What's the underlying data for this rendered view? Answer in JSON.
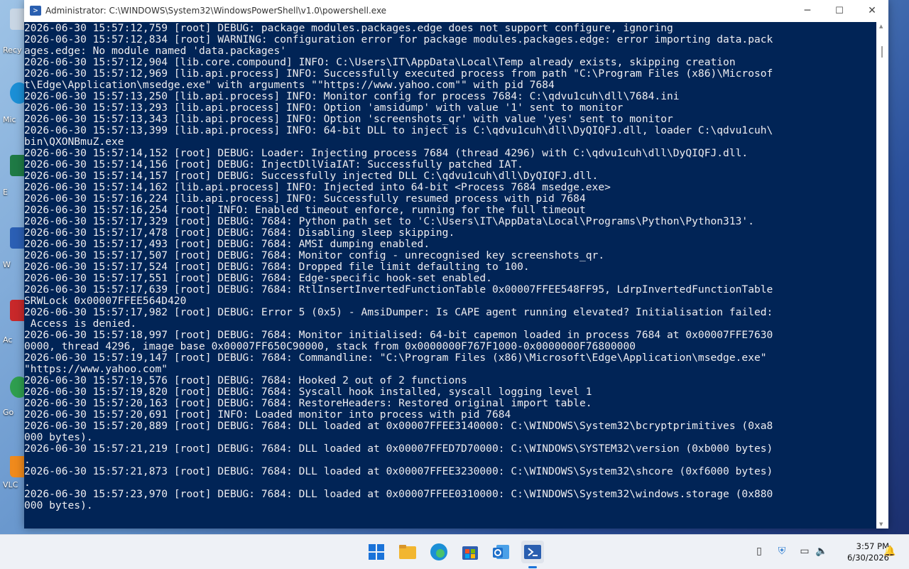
{
  "window": {
    "title": "Administrator: C:\\WINDOWS\\System32\\WindowsPowerShell\\v1.0\\powershell.exe",
    "icon": "powershell-icon",
    "controls": {
      "minimize": "─",
      "maximize": "☐",
      "close": "✕"
    }
  },
  "console": {
    "background": "#012456",
    "foreground": "#eeedf0",
    "lines": [
      "2026-06-30 15:57:12,759 [root] DEBUG: package modules.packages.edge does not support configure, ignoring",
      "2026-06-30 15:57:12,834 [root] WARNING: configuration error for package modules.packages.edge: error importing data.pack",
      "ages.edge: No module named 'data.packages'",
      "2026-06-30 15:57:12,904 [lib.core.compound] INFO: C:\\Users\\IT\\AppData\\Local\\Temp already exists, skipping creation",
      "2026-06-30 15:57:12,969 [lib.api.process] INFO: Successfully executed process from path \"C:\\Program Files (x86)\\Microsof",
      "t\\Edge\\Application\\msedge.exe\" with arguments \"\"https://www.yahoo.com\"\" with pid 7684",
      "2026-06-30 15:57:13,250 [lib.api.process] INFO: Monitor config for process 7684: C:\\qdvu1cuh\\dll\\7684.ini",
      "2026-06-30 15:57:13,293 [lib.api.process] INFO: Option 'amsidump' with value '1' sent to monitor",
      "2026-06-30 15:57:13,343 [lib.api.process] INFO: Option 'screenshots_qr' with value 'yes' sent to monitor",
      "2026-06-30 15:57:13,399 [lib.api.process] INFO: 64-bit DLL to inject is C:\\qdvu1cuh\\dll\\DyQIQFJ.dll, loader C:\\qdvu1cuh\\",
      "bin\\QXONBmuZ.exe",
      "2026-06-30 15:57:14,152 [root] DEBUG: Loader: Injecting process 7684 (thread 4296) with C:\\qdvu1cuh\\dll\\DyQIQFJ.dll.",
      "2026-06-30 15:57:14,156 [root] DEBUG: InjectDllViaIAT: Successfully patched IAT.",
      "2026-06-30 15:57:14,157 [root] DEBUG: Successfully injected DLL C:\\qdvu1cuh\\dll\\DyQIQFJ.dll.",
      "2026-06-30 15:57:14,162 [lib.api.process] INFO: Injected into 64-bit <Process 7684 msedge.exe>",
      "2026-06-30 15:57:16,224 [lib.api.process] INFO: Successfully resumed process with pid 7684",
      "2026-06-30 15:57:16,254 [root] INFO: Enabled timeout enforce, running for the full timeout",
      "2026-06-30 15:57:17,329 [root] DEBUG: 7684: Python path set to 'C:\\Users\\IT\\AppData\\Local\\Programs\\Python\\Python313'.",
      "2026-06-30 15:57:17,478 [root] DEBUG: 7684: Disabling sleep skipping.",
      "2026-06-30 15:57:17,493 [root] DEBUG: 7684: AMSI dumping enabled.",
      "2026-06-30 15:57:17,507 [root] DEBUG: 7684: Monitor config - unrecognised key screenshots_qr.",
      "2026-06-30 15:57:17,524 [root] DEBUG: 7684: Dropped file limit defaulting to 100.",
      "2026-06-30 15:57:17,551 [root] DEBUG: 7684: Edge-specific hook-set enabled.",
      "2026-06-30 15:57:17,639 [root] DEBUG: 7684: RtlInsertInvertedFunctionTable 0x00007FFEE548FF95, LdrpInvertedFunctionTable",
      "SRWLock 0x00007FFEE564D420",
      "2026-06-30 15:57:17,982 [root] DEBUG: Error 5 (0x5) - AmsiDumper: Is CAPE agent running elevated? Initialisation failed:",
      " Access is denied.",
      "2026-06-30 15:57:18,997 [root] DEBUG: 7684: Monitor initialised: 64-bit capemon loaded in process 7684 at 0x00007FFE7630",
      "0000, thread 4296, image base 0x00007FF650C90000, stack from 0x0000000F767F1000-0x0000000F76800000",
      "2026-06-30 15:57:19,147 [root] DEBUG: 7684: Commandline: \"C:\\Program Files (x86)\\Microsoft\\Edge\\Application\\msedge.exe\"",
      "\"https://www.yahoo.com\"",
      "2026-06-30 15:57:19,576 [root] DEBUG: 7684: Hooked 2 out of 2 functions",
      "2026-06-30 15:57:19,820 [root] DEBUG: 7684: Syscall hook installed, syscall logging level 1",
      "2026-06-30 15:57:20,163 [root] DEBUG: 7684: RestoreHeaders: Restored original import table.",
      "2026-06-30 15:57:20,691 [root] INFO: Loaded monitor into process with pid 7684",
      "2026-06-30 15:57:20,889 [root] DEBUG: 7684: DLL loaded at 0x00007FFEE3140000: C:\\WINDOWS\\System32\\bcryptprimitives (0xa8",
      "000 bytes).",
      "2026-06-30 15:57:21,219 [root] DEBUG: 7684: DLL loaded at 0x00007FFED7D70000: C:\\WINDOWS\\SYSTEM32\\version (0xb000 bytes)",
      ".",
      "2026-06-30 15:57:21,873 [root] DEBUG: 7684: DLL loaded at 0x00007FFEE3230000: C:\\WINDOWS\\System32\\shcore (0xf6000 bytes)",
      ".",
      "2026-06-30 15:57:23,970 [root] DEBUG: 7684: DLL loaded at 0x00007FFEE0310000: C:\\WINDOWS\\System32\\windows.storage (0x880",
      "000 bytes)."
    ]
  },
  "desktop": {
    "icons": [
      {
        "label": "Recy",
        "icon": "recycle-bin-icon",
        "color": "#c9d6e4"
      },
      {
        "label": "Mic",
        "icon": "edge-icon",
        "color": "#1b8fd6"
      },
      {
        "label": "E",
        "icon": "excel-icon",
        "color": "#1f7a45"
      },
      {
        "label": "W",
        "icon": "word-icon",
        "color": "#2b5fb4"
      },
      {
        "label": "Ac",
        "icon": "acrobat-icon",
        "color": "#c8282a"
      },
      {
        "label": "Go",
        "icon": "chrome-icon",
        "color": "#2f9e4f"
      },
      {
        "label": "VLC",
        "icon": "vlc-icon",
        "color": "#f08a1c"
      }
    ]
  },
  "taskbar": {
    "apps": [
      {
        "name": "start",
        "icon": "windows-start-icon",
        "color": "#1a73d9"
      },
      {
        "name": "file-explorer",
        "icon": "folder-icon",
        "color": "#f2b630"
      },
      {
        "name": "edge",
        "icon": "edge-icon",
        "color": "#1b8fd6"
      },
      {
        "name": "store",
        "icon": "store-icon",
        "color": "#2f5fb0"
      },
      {
        "name": "outlook",
        "icon": "outlook-icon",
        "color": "#1e6fc9"
      },
      {
        "name": "powershell",
        "icon": "powershell-icon",
        "color": "#2a5fb0"
      }
    ],
    "tray": [
      "usb-icon",
      "security-icon",
      "display-icon",
      "volume-icon"
    ],
    "clock": {
      "time": "3:57 PM",
      "date": "6/30/2026"
    }
  }
}
